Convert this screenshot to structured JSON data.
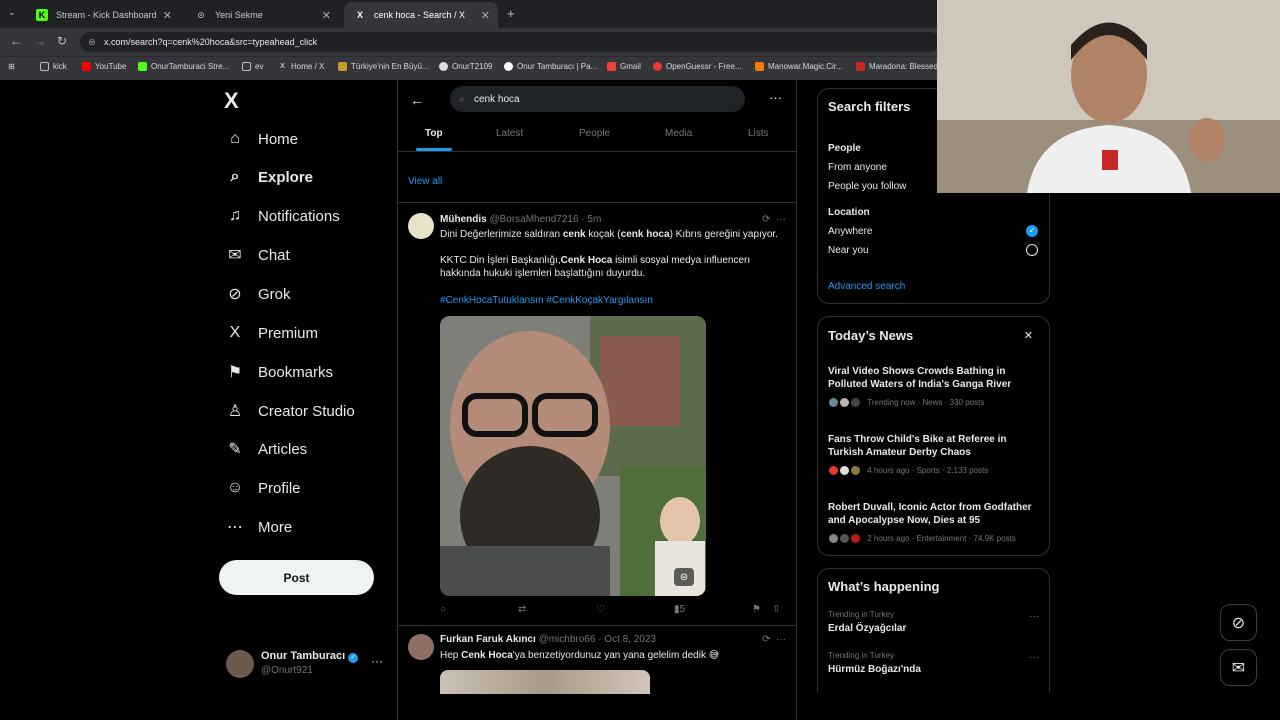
{
  "browser": {
    "tabs": [
      {
        "label": "Stream - Kick Dashboard",
        "icon": "K"
      },
      {
        "label": "Yeni Sekme",
        "icon": "⊙"
      },
      {
        "label": "cenk hoca - Search / X",
        "icon": "X"
      }
    ],
    "new_tab": "+",
    "url": "x.com/search?q=cenk%20hoca&src=typeahead_click",
    "bookmarks": [
      "kick",
      "YouTube",
      "OnurTamburaci Stre...",
      "ev",
      "Home / X",
      "Türkiye'nin En Büyü...",
      "OnurT2109",
      "Onur Tamburacı | Pa...",
      "Gmail",
      "OpenGuessr - Free...",
      "Manowar.Magic.Cir...",
      "Maradona: Blessed..."
    ]
  },
  "nav": {
    "logo": "X",
    "items": [
      {
        "label": "Home",
        "icon": "⌂"
      },
      {
        "label": "Explore",
        "icon": "⌕"
      },
      {
        "label": "Notifications",
        "icon": "♫"
      },
      {
        "label": "Chat",
        "icon": "✉"
      },
      {
        "label": "Grok",
        "icon": "⊘"
      },
      {
        "label": "Premium",
        "icon": "X"
      },
      {
        "label": "Bookmarks",
        "icon": "⚑"
      },
      {
        "label": "Creator Studio",
        "icon": "♙"
      },
      {
        "label": "Articles",
        "icon": "✎"
      },
      {
        "label": "Profile",
        "icon": "☺"
      },
      {
        "label": "More",
        "icon": "⋯"
      }
    ],
    "post_label": "Post",
    "profile_name": "Onur Tamburacı",
    "profile_handle": "@Onurt921",
    "more": "···"
  },
  "search": {
    "query": "cenk hoca",
    "back": "←",
    "menu": "···",
    "tabs": [
      "Top",
      "Latest",
      "People",
      "Media",
      "Lists"
    ],
    "view_all": "View all"
  },
  "tweets": [
    {
      "name": "Mühendis",
      "handle": "@BorsaMhend7216 · 5m",
      "line1_pre": "Dini Değerlerimize saldıran ",
      "line1_b1": "cenk",
      "line1_mid": " koçak (",
      "line1_b2": "cenk hoca",
      "line1_post": ") Kıbrıs gereğini yapıyor.",
      "para2_pre": "KKTC Din İşleri Başkanlığı,",
      "para2_b": "Cenk Hoca",
      "para2_post": " isimli sosyal medya influencerı hakkında hukuki işlemleri başlattığını duyurdu.",
      "hashtags": "#CenkHocaTutuklansın #CenkKoçakYargılansın",
      "views": "15"
    },
    {
      "name": "Furkan Faruk Akıncı",
      "handle": "@michbro66 · Oct 8, 2023",
      "text_pre": "Hep ",
      "text_b": "Cenk Hoca",
      "text_post": "'ya benzetiyordunuz yan yana gelelim dedik 😅"
    }
  ],
  "filters": {
    "title": "Search filters",
    "people_label": "People",
    "from_anyone": "From anyone",
    "people_follow": "People you follow",
    "location_label": "Location",
    "anywhere": "Anywhere",
    "near_you": "Near you",
    "advanced": "Advanced search"
  },
  "news": {
    "title": "Today’s News",
    "close": "✕",
    "items": [
      {
        "title": "Viral Video Shows Crowds Bathing in Polluted Waters of India's Ganga River",
        "meta": "Trending now · News · 330 posts"
      },
      {
        "title": "Fans Throw Child's Bike at Referee in Turkish Amateur Derby Chaos",
        "meta": "4 hours ago · Sports · 2,133 posts"
      },
      {
        "title": "Robert Duvall, Iconic Actor from Godfather and Apocalypse Now, Dies at 95",
        "meta": "2 hours ago · Entertainment · 74.9K posts"
      }
    ]
  },
  "happening": {
    "title": "What’s happening",
    "items": [
      {
        "context": "Trending in Turkey",
        "topic": "Erdal Özyağcılar"
      },
      {
        "context": "Trending in Turkey",
        "topic": "Hürmüz Boğazı'nda"
      }
    ]
  },
  "colors": {
    "accent": "#1d9bf0",
    "bg": "#000000",
    "border": "#2f3336"
  }
}
